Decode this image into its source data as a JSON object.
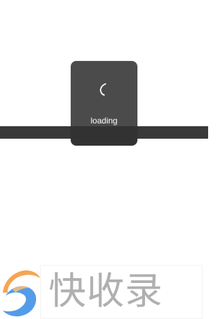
{
  "loading_toast": {
    "label": "loading"
  },
  "watermark": {
    "text": "快收录"
  },
  "colors": {
    "toast_bg": "#4b4b4b",
    "overlay_band": "#1e1e1e",
    "watermark_text": "#8f8f8f",
    "watermark_orange": "#f39a3d",
    "watermark_blue": "#3d8fe6"
  },
  "icons": {
    "spinner": "spinner-icon",
    "watermark_logo": "watermark-logo-icon"
  }
}
